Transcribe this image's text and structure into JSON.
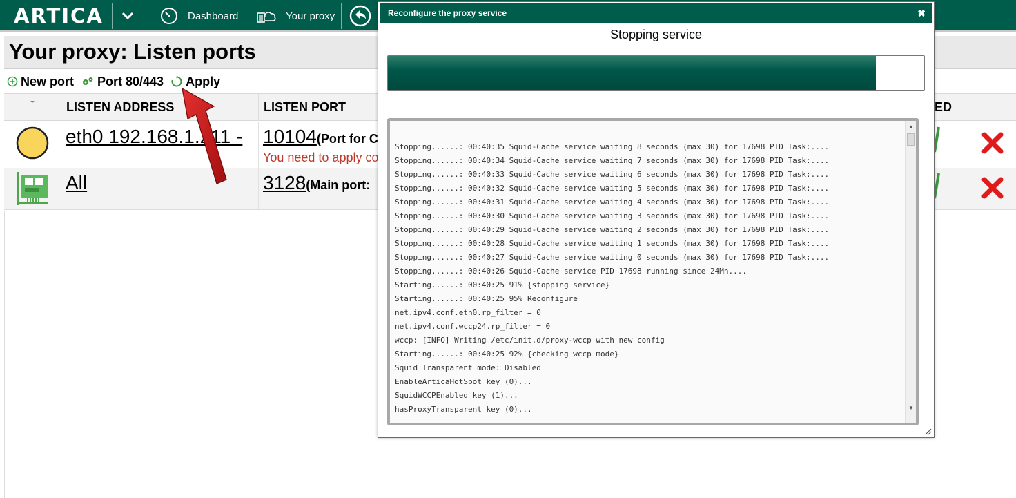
{
  "app": {
    "logo_text": "ARTICA"
  },
  "nav": {
    "dashboard_label": "Dashboard",
    "your_proxy_label": "Your proxy"
  },
  "page": {
    "title": "Your proxy: Listen ports",
    "toolbar": {
      "new_port": "New port",
      "port_80_443": "Port 80/443",
      "apply": "Apply"
    },
    "table": {
      "headers": {
        "listen_address": "LISTEN ADDRESS",
        "listen_port": "LISTEN PORT",
        "enabled_partial": "LED"
      },
      "rows": [
        {
          "address": "eth0 192.168.1.211 -",
          "port": "10104",
          "port_note": "(Port for C",
          "warning": "You need to apply co"
        },
        {
          "address": "All",
          "port": "3128",
          "port_note": "(Main port:"
        }
      ]
    }
  },
  "modal": {
    "title": "Reconfigure the proxy service",
    "close_symbol": "✖",
    "status": "Stopping service",
    "progress_percent": 91,
    "log_lines": [
      "Stopping......: 00:40:35 Squid-Cache service waiting 8 seconds (max 30) for 17698 PID Task:....",
      "Stopping......: 00:40:34 Squid-Cache service waiting 7 seconds (max 30) for 17698 PID Task:....",
      "Stopping......: 00:40:33 Squid-Cache service waiting 6 seconds (max 30) for 17698 PID Task:....",
      "Stopping......: 00:40:32 Squid-Cache service waiting 5 seconds (max 30) for 17698 PID Task:....",
      "Stopping......: 00:40:31 Squid-Cache service waiting 4 seconds (max 30) for 17698 PID Task:....",
      "Stopping......: 00:40:30 Squid-Cache service waiting 3 seconds (max 30) for 17698 PID Task:....",
      "Stopping......: 00:40:29 Squid-Cache service waiting 2 seconds (max 30) for 17698 PID Task:....",
      "Stopping......: 00:40:28 Squid-Cache service waiting 1 seconds (max 30) for 17698 PID Task:....",
      "Stopping......: 00:40:27 Squid-Cache service waiting 0 seconds (max 30) for 17698 PID Task:....",
      "Stopping......: 00:40:26 Squid-Cache service PID 17698 running since 24Mn....",
      "Starting......: 00:40:25 91% {stopping_service}",
      "Starting......: 00:40:25 95% Reconfigure",
      "net.ipv4.conf.eth0.rp_filter = 0",
      "net.ipv4.conf.wccp24.rp_filter = 0",
      "wccp: [INFO] Writing /etc/init.d/proxy-wccp with new config",
      "Starting......: 00:40:25 92% {checking_wccp_mode}",
      "Squid Transparent mode: Disabled",
      "EnableArticaHotSpot key (0)...",
      "SquidWCCPEnabled key (1)...",
      "hasProxyTransparent key (0)..."
    ]
  }
}
